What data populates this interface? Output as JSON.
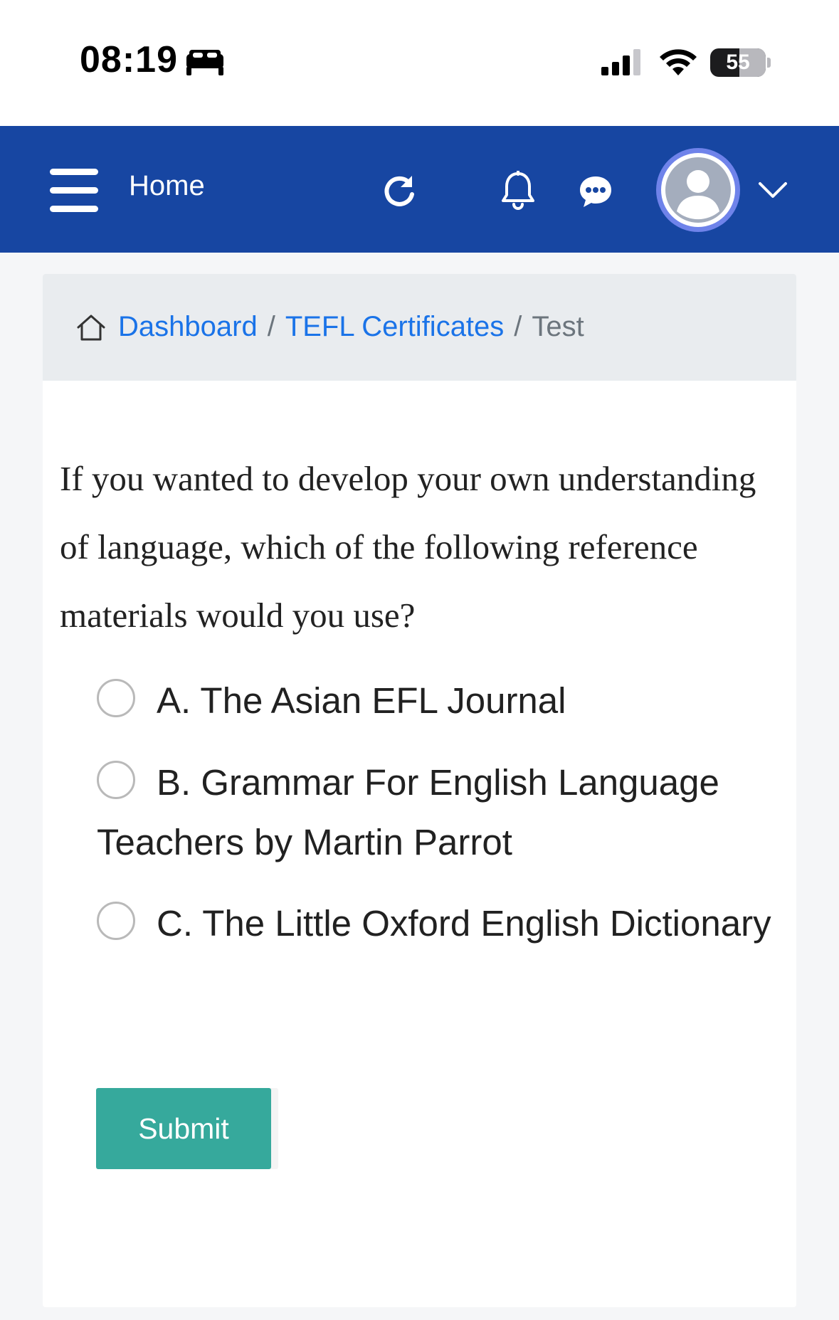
{
  "status_bar": {
    "time": "08:19",
    "battery_level": "55",
    "icons": [
      "sleep-focus-icon",
      "signal-icon",
      "wifi-icon",
      "battery-icon"
    ]
  },
  "header": {
    "menu_icon": "hamburger-menu-icon",
    "home_label": "Home",
    "icons": [
      "refresh-icon",
      "bell-icon",
      "chat-icon",
      "avatar",
      "chevron-down-icon"
    ],
    "background_color": "#1746a2"
  },
  "breadcrumb": {
    "home_icon": "house-icon",
    "items": [
      {
        "label": "Dashboard"
      },
      {
        "label": "TEFL Certificates"
      },
      {
        "label": "Test"
      }
    ],
    "separator": "/"
  },
  "quiz": {
    "question": "If you wanted to develop your own understanding of language, which of the following reference materials would you use?",
    "options": [
      {
        "label": "A. The Asian EFL Journal",
        "selected": false
      },
      {
        "label": "B. Grammar For English Language Teachers by Martin Parrot",
        "selected": false
      },
      {
        "label": "C. The Little Oxford English Dictionary",
        "selected": false
      }
    ],
    "submit_label": "Submit",
    "submit_color": "#36a99c"
  }
}
